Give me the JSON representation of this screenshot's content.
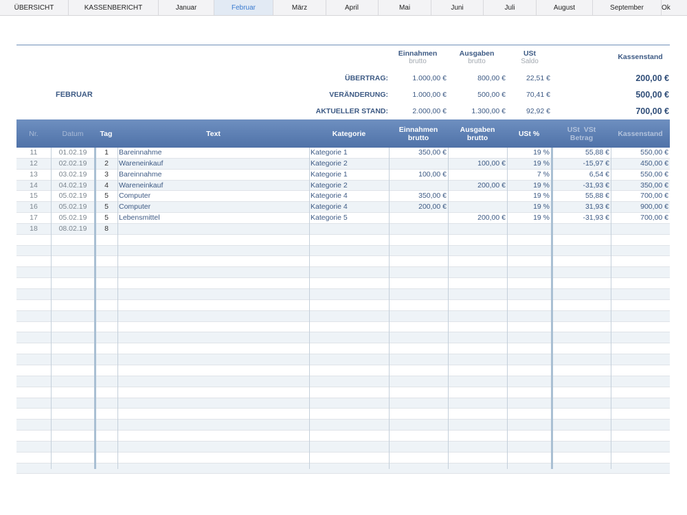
{
  "tabs": [
    {
      "label": "ÜBERSICHT",
      "active": false
    },
    {
      "label": "KASSENBERICHT",
      "active": false
    },
    {
      "label": "Januar",
      "active": false
    },
    {
      "label": "Februar",
      "active": true
    },
    {
      "label": "März",
      "active": false
    },
    {
      "label": "April",
      "active": false
    },
    {
      "label": "Mai",
      "active": false
    },
    {
      "label": "Juni",
      "active": false
    },
    {
      "label": "Juli",
      "active": false
    },
    {
      "label": "August",
      "active": false
    },
    {
      "label": "September",
      "active": false
    },
    {
      "label": "Ok",
      "active": false
    }
  ],
  "summary": {
    "month": "FEBRUAR",
    "headers": {
      "einnahmen": "Einnahmen",
      "einnahmen_sub": "brutto",
      "ausgaben": "Ausgaben",
      "ausgaben_sub": "brutto",
      "ust": "USt",
      "ust_sub": "Saldo",
      "kassenstand": "Kassenstand"
    },
    "rows": [
      {
        "label": "ÜBERTRAG:",
        "einnahmen": "1.000,00 €",
        "ausgaben": "800,00 €",
        "ust": "22,51 €",
        "kassenstand": "200,00 €"
      },
      {
        "label": "VERÄNDERUNG:",
        "einnahmen": "1.000,00 €",
        "ausgaben": "500,00 €",
        "ust": "70,41 €",
        "kassenstand": "500,00 €"
      },
      {
        "label": "AKTUELLER STAND:",
        "einnahmen": "2.000,00 €",
        "ausgaben": "1.300,00 €",
        "ust": "92,92 €",
        "kassenstand": "700,00 €"
      }
    ]
  },
  "table": {
    "headers": {
      "nr": "Nr.",
      "datum": "Datum",
      "tag": "Tag",
      "text": "Text",
      "kategorie": "Kategorie",
      "einnahmen": "Einnahmen",
      "einnahmen_sub": "brutto",
      "ausgaben": "Ausgaben",
      "ausgaben_sub": "brutto",
      "ust_pct": "USt %",
      "ust_vst": "USt  VSt",
      "ust_vst_sub": "Betrag",
      "kassenstand": "Kassenstand"
    },
    "rows": [
      {
        "nr": "11",
        "datum": "01.02.19",
        "tag": "1",
        "text": "Bareinnahme",
        "kategorie": "Kategorie 1",
        "einnahmen": "350,00 €",
        "ausgaben": "",
        "ust": "19 %",
        "betrag": "55,88 €",
        "kassenstand": "550,00 €"
      },
      {
        "nr": "12",
        "datum": "02.02.19",
        "tag": "2",
        "text": "Wareneinkauf",
        "kategorie": "Kategorie 2",
        "einnahmen": "",
        "ausgaben": "100,00 €",
        "ust": "19 %",
        "betrag": "-15,97 €",
        "kassenstand": "450,00 €"
      },
      {
        "nr": "13",
        "datum": "03.02.19",
        "tag": "3",
        "text": "Bareinnahme",
        "kategorie": "Kategorie 1",
        "einnahmen": "100,00 €",
        "ausgaben": "",
        "ust": "7 %",
        "betrag": "6,54 €",
        "kassenstand": "550,00 €"
      },
      {
        "nr": "14",
        "datum": "04.02.19",
        "tag": "4",
        "text": "Wareneinkauf",
        "kategorie": "Kategorie 2",
        "einnahmen": "",
        "ausgaben": "200,00 €",
        "ust": "19 %",
        "betrag": "-31,93 €",
        "kassenstand": "350,00 €"
      },
      {
        "nr": "15",
        "datum": "05.02.19",
        "tag": "5",
        "text": "Computer",
        "kategorie": "Kategorie 4",
        "einnahmen": "350,00 €",
        "ausgaben": "",
        "ust": "19 %",
        "betrag": "55,88 €",
        "kassenstand": "700,00 €"
      },
      {
        "nr": "16",
        "datum": "05.02.19",
        "tag": "5",
        "text": "Computer",
        "kategorie": "Kategorie 4",
        "einnahmen": "200,00 €",
        "ausgaben": "",
        "ust": "19 %",
        "betrag": "31,93 €",
        "kassenstand": "900,00 €"
      },
      {
        "nr": "17",
        "datum": "05.02.19",
        "tag": "5",
        "text": "Lebensmittel",
        "kategorie": "Kategorie 5",
        "einnahmen": "",
        "ausgaben": "200,00 €",
        "ust": "19 %",
        "betrag": "-31,93 €",
        "kassenstand": "700,00 €"
      },
      {
        "nr": "18",
        "datum": "08.02.19",
        "tag": "8",
        "text": "",
        "kategorie": "",
        "einnahmen": "",
        "ausgaben": "",
        "ust": "",
        "betrag": "",
        "kassenstand": ""
      }
    ],
    "empty_rows": 22
  }
}
